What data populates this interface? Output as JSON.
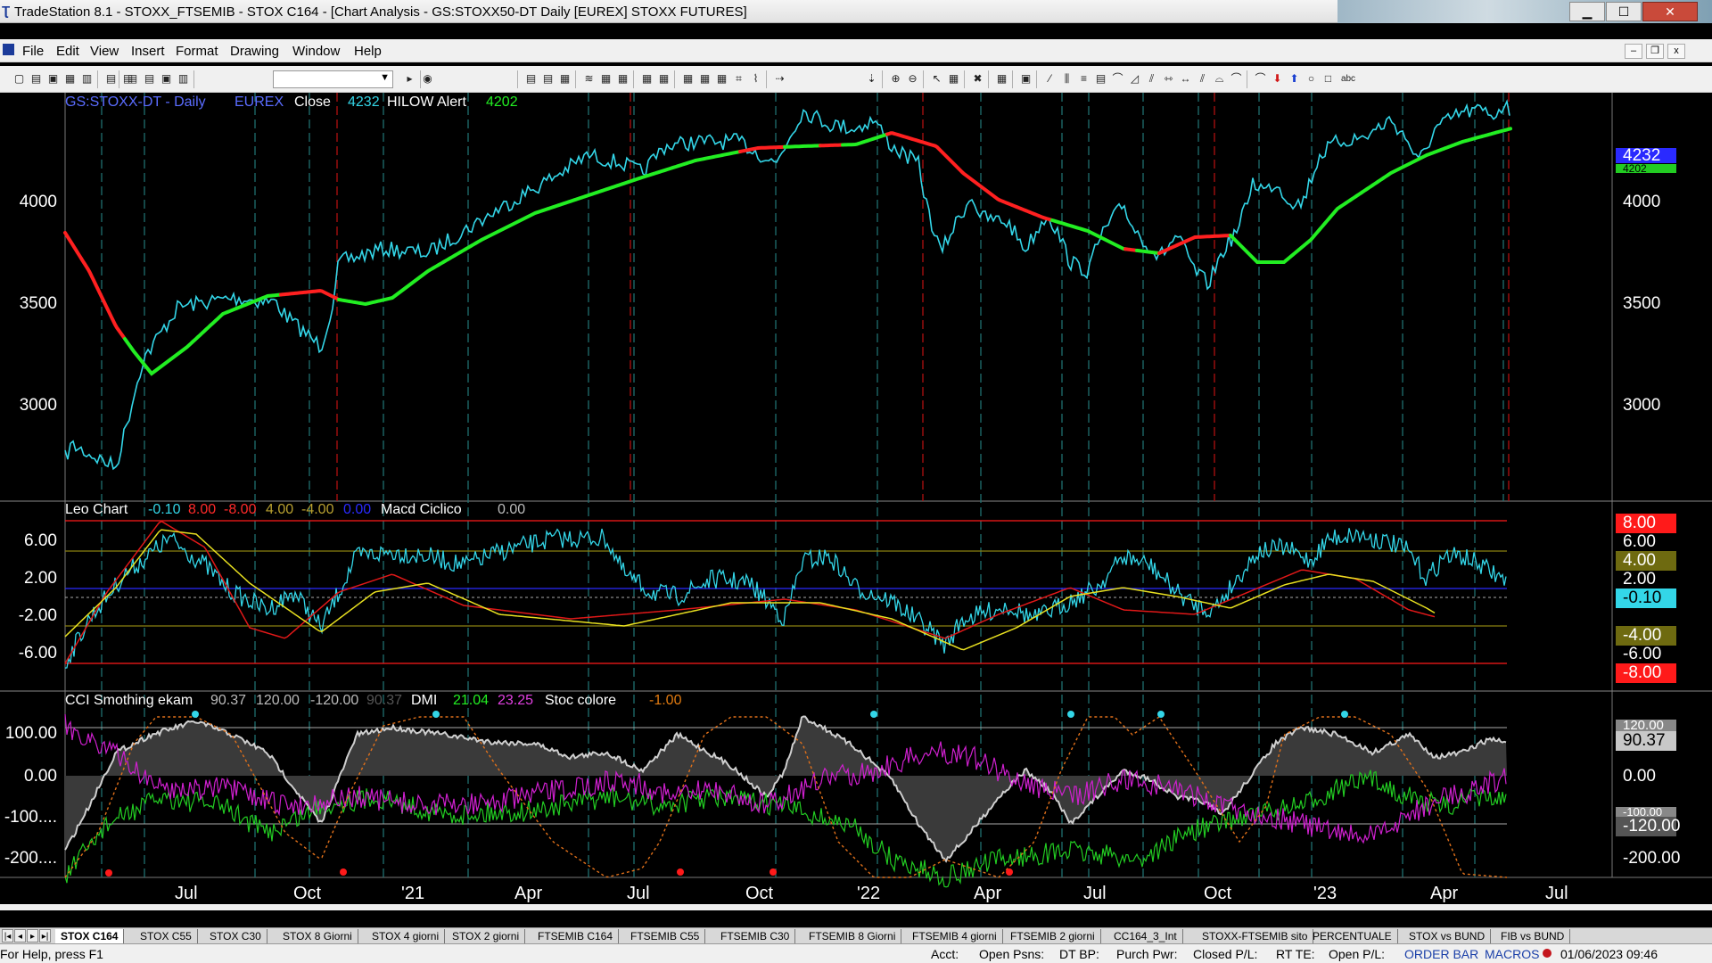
{
  "window": {
    "title": "TradeStation 8.1 - STOXX_FTSEMIB - STOX C164 - [Chart Analysis - GS:STOXX50-DT  Daily  [EUREX] STOXX FUTURES]",
    "min": "▁",
    "max": "☐",
    "close": "✕"
  },
  "menu": [
    "File",
    "Edit",
    "View",
    "Insert",
    "Format",
    "Drawing",
    "Window",
    "Help"
  ],
  "mdi": {
    "min": "–",
    "restore": "❐",
    "close": "x"
  },
  "price_pane": {
    "symbol": "GS:STOXX-DT - Daily",
    "exchange": "EUREX",
    "close_label": "Close",
    "close_value": "4232",
    "alert_label": "HILOW Alert",
    "alert_value": "4202",
    "y_ticks": [
      "4000",
      "3500",
      "3000"
    ],
    "tag_close": "4232",
    "tag_alert": "4202"
  },
  "leo_pane": {
    "name": "Leo Chart",
    "v1": "-0.10",
    "v2": "8.00",
    "v3": "-8.00",
    "v4": "4.00",
    "v5": "-4.00",
    "v6": "0.00",
    "macd_label": "Macd Ciclico",
    "macd_value": "0.00",
    "y_ticks": [
      "6.00",
      "2.00",
      "-2.00",
      "-6.00"
    ],
    "right_ticks": [
      "6.00",
      "2.00",
      "-6.00"
    ],
    "tags": {
      "t8": "8.00",
      "t4": "4.00",
      "t0": "-0.10",
      "tm4": "-4.00",
      "tm8": "-8.00"
    }
  },
  "cci_pane": {
    "name": "CCI Smothing ekam",
    "v1": "90.37",
    "v2": "120.00",
    "v3": "-120.00",
    "v4": "90.37",
    "dmi_label": "DMI",
    "dmi_plus": "21.04",
    "dmi_minus": "23.25",
    "stoc_label": "Stoc colore",
    "stoc_value": "-1.00",
    "y_ticks": [
      "100.00",
      "0.00",
      "-100....",
      "-200...."
    ],
    "right_ticks": [
      "0.00",
      "-200.00"
    ],
    "tags": {
      "t120": "120.00",
      "tval": "90.37",
      "tm100": "-100.00",
      "tm120": "-120.00"
    }
  },
  "x_axis": [
    "Jul",
    "Oct",
    "'21",
    "Apr",
    "Jul",
    "Oct",
    "'22",
    "Apr",
    "Jul",
    "Oct",
    "'23",
    "Apr",
    "Jul"
  ],
  "sheet_tabs": [
    "STOX C164",
    "STOX C55",
    "STOX  C30",
    "STOX  8 Giorni",
    "STOX 4 giorni",
    "STOX  2 giorni",
    "FTSEMIB C164",
    "FTSEMIB C55",
    "FTSEMIB C30",
    "FTSEMIB  8 Giorni",
    "FTSEMIB  4 giorni",
    "FTSEMIB  2 giorni",
    "CC164_3_Int",
    "STOXX-FTSEMIB sito",
    "PERCENTUALE",
    "STOX vs BUND",
    "FIB vs BUND"
  ],
  "status": {
    "help": "For Help, press F1",
    "acct": "Acct:",
    "open_psns": "Open Psns:",
    "dt_bp": "DT BP:",
    "purch_pwr": "Purch Pwr:",
    "closed_pl": "Closed P/L:",
    "rt_te": "RT TE:",
    "open_pl": "Open P/L:",
    "order_bar": "ORDER BAR",
    "macros": "MACROS",
    "datetime": "01/06/2023 09:46"
  },
  "colors": {
    "cyan": "#33d6e8",
    "red": "#ff1a1a",
    "green": "#22ee22",
    "yellow": "#e8e020",
    "magenta": "#d020d0",
    "blue": "#2a2aff"
  }
}
